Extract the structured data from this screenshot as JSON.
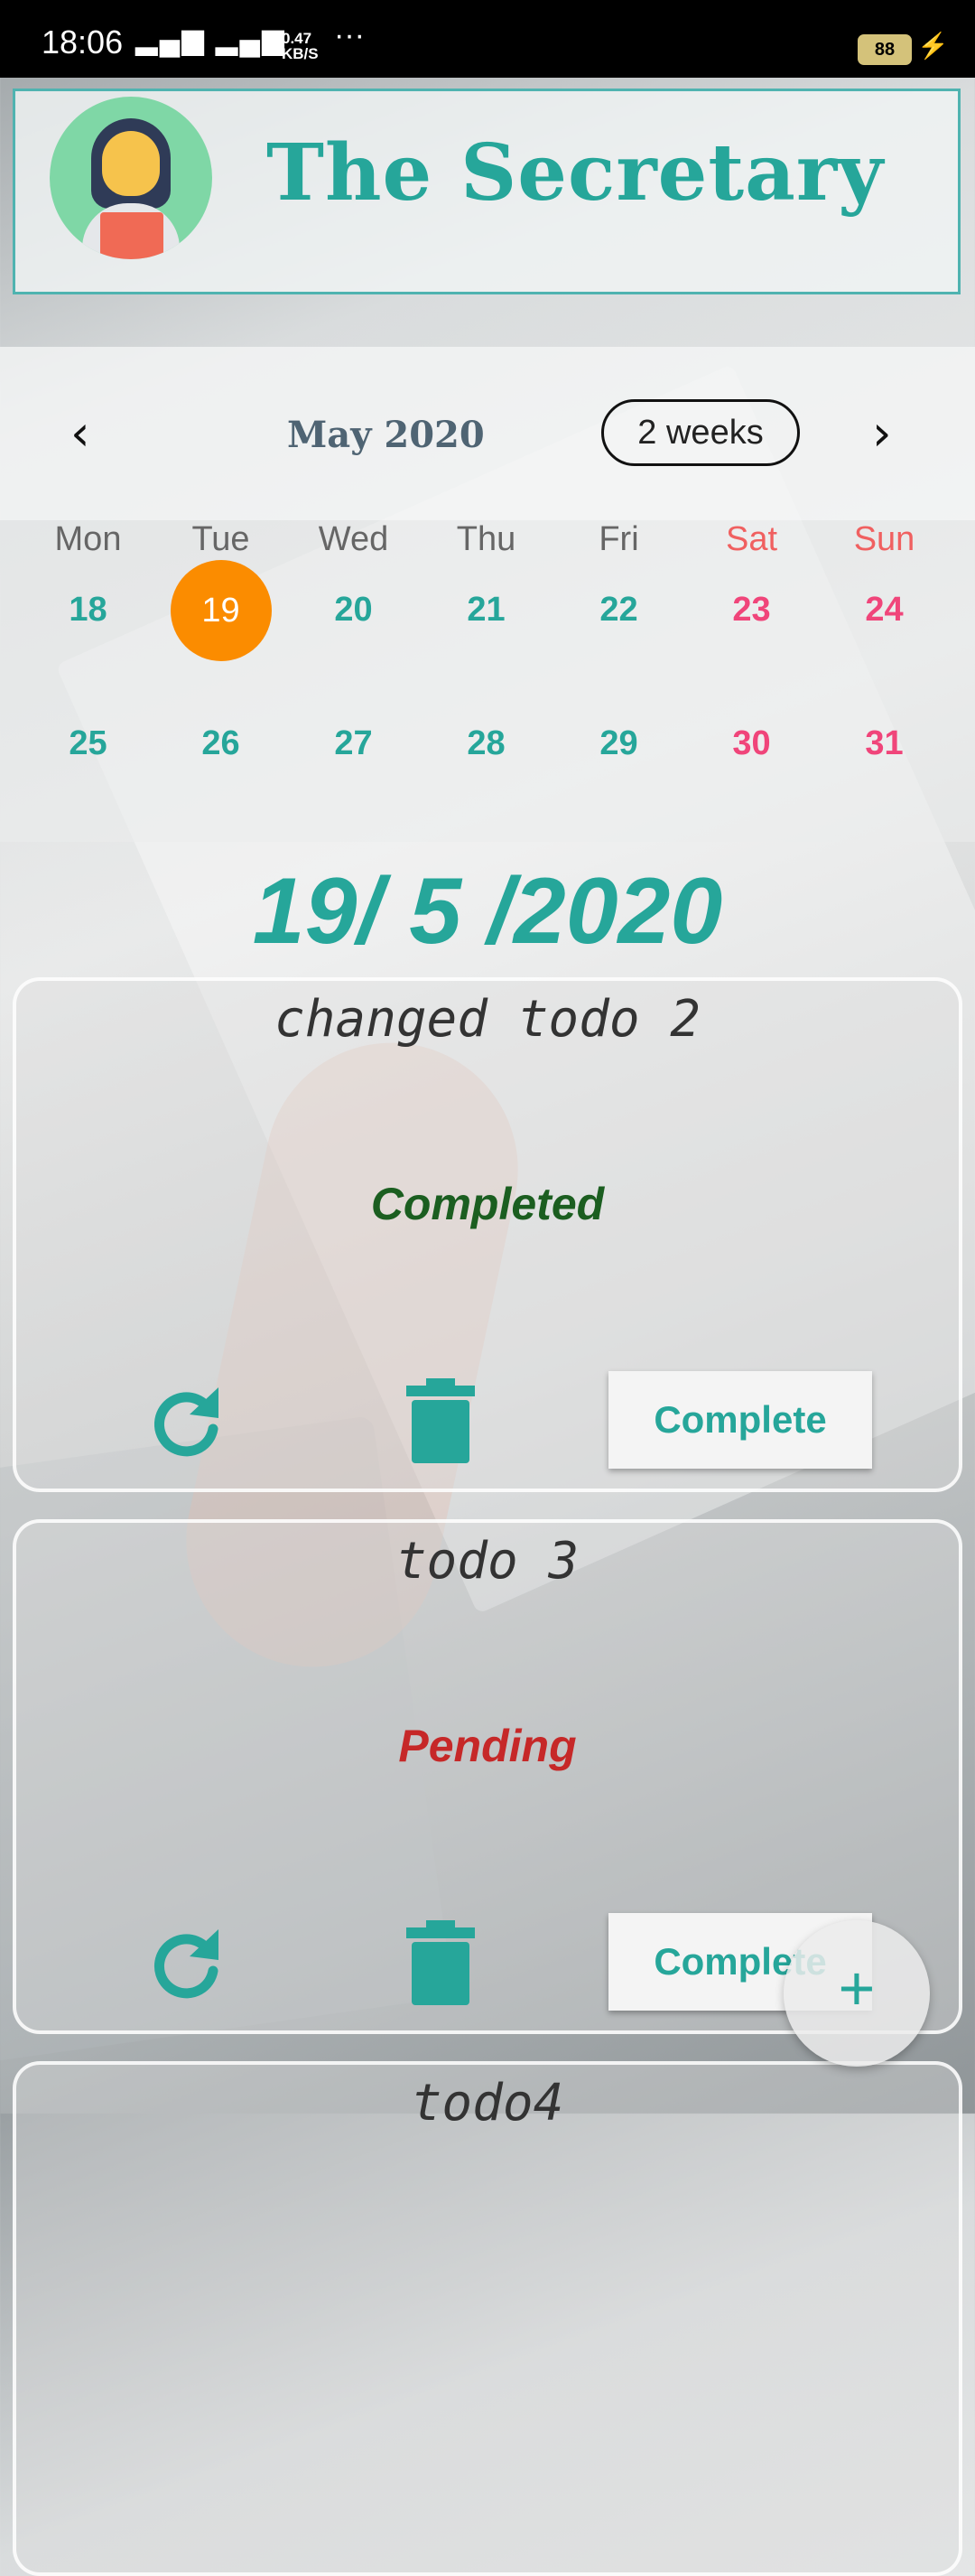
{
  "status_bar": {
    "time": "18:06",
    "signal": "▂▄▆ ▂▄▆",
    "speed_value": "0.47",
    "speed_unit": "KB/S",
    "more": "···",
    "battery": "88"
  },
  "header": {
    "title": "The Secretary"
  },
  "calendar": {
    "month_label": "May 2020",
    "format_button": "2 weeks",
    "weekdays": [
      "Mon",
      "Tue",
      "Wed",
      "Thu",
      "Fri",
      "Sat",
      "Sun"
    ],
    "week1": [
      "18",
      "19",
      "20",
      "21",
      "22",
      "23",
      "24"
    ],
    "week2": [
      "25",
      "26",
      "27",
      "28",
      "29",
      "30",
      "31"
    ],
    "selected_day": "19"
  },
  "selected_date": "19/ 5 /2020",
  "todos": [
    {
      "title": "changed todo 2",
      "status": "Completed",
      "button": "Complete"
    },
    {
      "title": "todo 3",
      "status": "Pending",
      "button": "Complete"
    },
    {
      "title": "todo4"
    }
  ],
  "fab_label": "+",
  "colors": {
    "accent": "#26a69a",
    "selected_day": "#fb8c00",
    "weekend": "#f0457a",
    "completed": "#1b5e20",
    "pending": "#c62828"
  }
}
